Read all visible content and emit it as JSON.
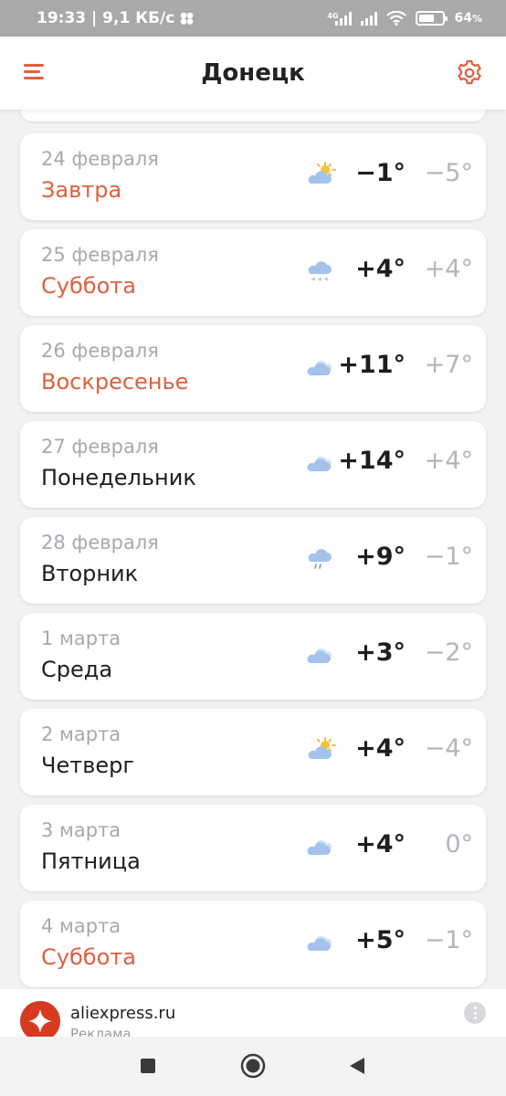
{
  "status_bar": {
    "time_speed": "19:33 | 9,1 КБ/с",
    "network_badge": "4G",
    "battery": "64",
    "battery_unit": "%",
    "battery_level": 0.64
  },
  "header": {
    "city": "Донецк",
    "menu_icon": "hamburger-menu-icon",
    "settings_icon": "gear-icon"
  },
  "colors": {
    "accent": "#e0603f",
    "muted": "#a6a9b2",
    "night_temp": "#b3b5be"
  },
  "forecast": [
    {
      "date": "24 февраля",
      "weekday": "Завтра",
      "weekend": true,
      "icon": "partly-cloudy-sun-icon",
      "day": "−1°",
      "night": "−5°"
    },
    {
      "date": "25 февраля",
      "weekday": "Суббота",
      "weekend": true,
      "icon": "snow-cloud-icon",
      "day": "+4°",
      "night": "+4°"
    },
    {
      "date": "26 февраля",
      "weekday": "Воскресенье",
      "weekend": true,
      "icon": "cloudy-icon",
      "day": "+11°",
      "night": "+7°"
    },
    {
      "date": "27 февраля",
      "weekday": "Понедельник",
      "weekend": false,
      "icon": "cloudy-icon",
      "day": "+14°",
      "night": "+4°"
    },
    {
      "date": "28 февраля",
      "weekday": "Вторник",
      "weekend": false,
      "icon": "rain-cloud-icon",
      "day": "+9°",
      "night": "−1°"
    },
    {
      "date": "1 марта",
      "weekday": "Среда",
      "weekend": false,
      "icon": "cloudy-icon",
      "day": "+3°",
      "night": "−2°"
    },
    {
      "date": "2 марта",
      "weekday": "Четверг",
      "weekend": false,
      "icon": "partly-cloudy-sun-icon",
      "day": "+4°",
      "night": "−4°"
    },
    {
      "date": "3 марта",
      "weekday": "Пятница",
      "weekend": false,
      "icon": "cloudy-icon",
      "day": "+4°",
      "night": "0°"
    },
    {
      "date": "4 марта",
      "weekday": "Суббота",
      "weekend": true,
      "icon": "cloudy-icon",
      "day": "+5°",
      "night": "−1°"
    }
  ],
  "ad": {
    "title": "aliexpress.ru",
    "label": "Реклама",
    "logo_icon": "aliexpress-logo-icon",
    "more_icon": "more-vertical-icon"
  },
  "nav_bar": {
    "recent_icon": "square-recents-icon",
    "home_icon": "circle-home-icon",
    "back_icon": "triangle-back-icon"
  }
}
